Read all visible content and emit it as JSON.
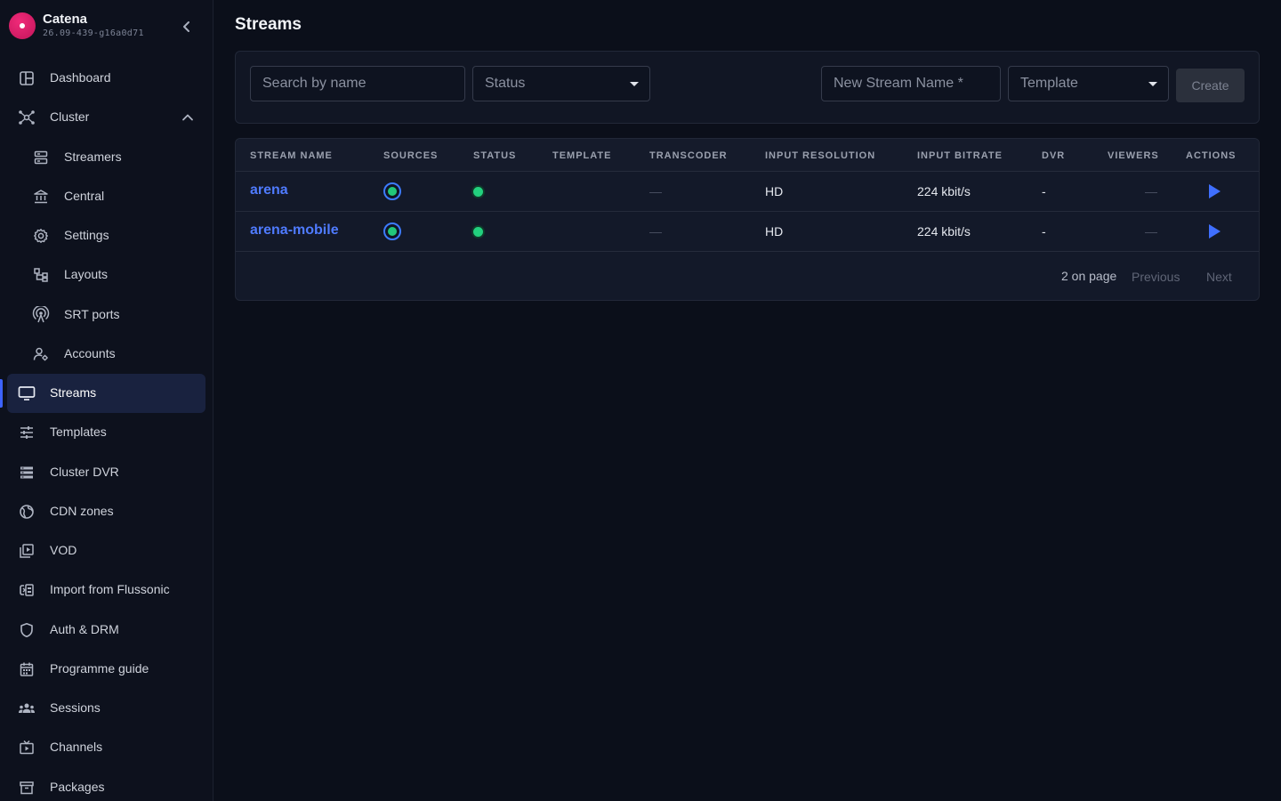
{
  "app": {
    "name": "Catena",
    "version": "26.09-439-g16a0d71"
  },
  "sidebar": {
    "items": [
      {
        "label": "Dashboard",
        "icon": "dashboard-icon"
      },
      {
        "label": "Cluster",
        "icon": "cluster-icon",
        "expanded": true
      },
      {
        "label": "Streamers",
        "icon": "server-icon",
        "sub": true
      },
      {
        "label": "Central",
        "icon": "bank-icon",
        "sub": true
      },
      {
        "label": "Settings",
        "icon": "gear-icon",
        "sub": true
      },
      {
        "label": "Layouts",
        "icon": "layout-icon",
        "sub": true
      },
      {
        "label": "SRT ports",
        "icon": "antenna-icon",
        "sub": true
      },
      {
        "label": "Accounts",
        "icon": "accounts-icon",
        "sub": true
      },
      {
        "label": "Streams",
        "icon": "monitor-icon",
        "active": true
      },
      {
        "label": "Templates",
        "icon": "sliders-icon"
      },
      {
        "label": "Cluster DVR",
        "icon": "storage-icon"
      },
      {
        "label": "CDN zones",
        "icon": "globe-icon"
      },
      {
        "label": "VOD",
        "icon": "video-library-icon"
      },
      {
        "label": "Import from Flussonic",
        "icon": "import-icon"
      },
      {
        "label": "Auth & DRM",
        "icon": "shield-icon"
      },
      {
        "label": "Programme guide",
        "icon": "calendar-icon"
      },
      {
        "label": "Sessions",
        "icon": "users-icon"
      },
      {
        "label": "Channels",
        "icon": "tv-icon"
      },
      {
        "label": "Packages",
        "icon": "archive-icon"
      }
    ]
  },
  "page": {
    "title": "Streams"
  },
  "toolbar": {
    "search_placeholder": "Search by name",
    "status_placeholder": "Status",
    "new_stream_placeholder": "New Stream Name *",
    "template_placeholder": "Template",
    "create_label": "Create"
  },
  "table": {
    "columns": [
      "STREAM NAME",
      "SOURCES",
      "STATUS",
      "TEMPLATE",
      "TRANSCODER",
      "INPUT RESOLUTION",
      "INPUT BITRATE",
      "DVR",
      "VIEWERS",
      "ACTIONS"
    ],
    "rows": [
      {
        "name": "arena",
        "template": "",
        "transcoder": "—",
        "resolution": "HD",
        "bitrate": "224 kbit/s",
        "dvr": "-",
        "viewers": "—"
      },
      {
        "name": "arena-mobile",
        "template": "",
        "transcoder": "—",
        "resolution": "HD",
        "bitrate": "224 kbit/s",
        "dvr": "-",
        "viewers": "—"
      }
    ]
  },
  "pagination": {
    "count": "2 on page",
    "previous": "Previous",
    "next": "Next"
  },
  "colors": {
    "accent": "#3d63ff",
    "link": "#4f7bff",
    "status_ok": "#22d07e",
    "brand": "#e0206d"
  }
}
